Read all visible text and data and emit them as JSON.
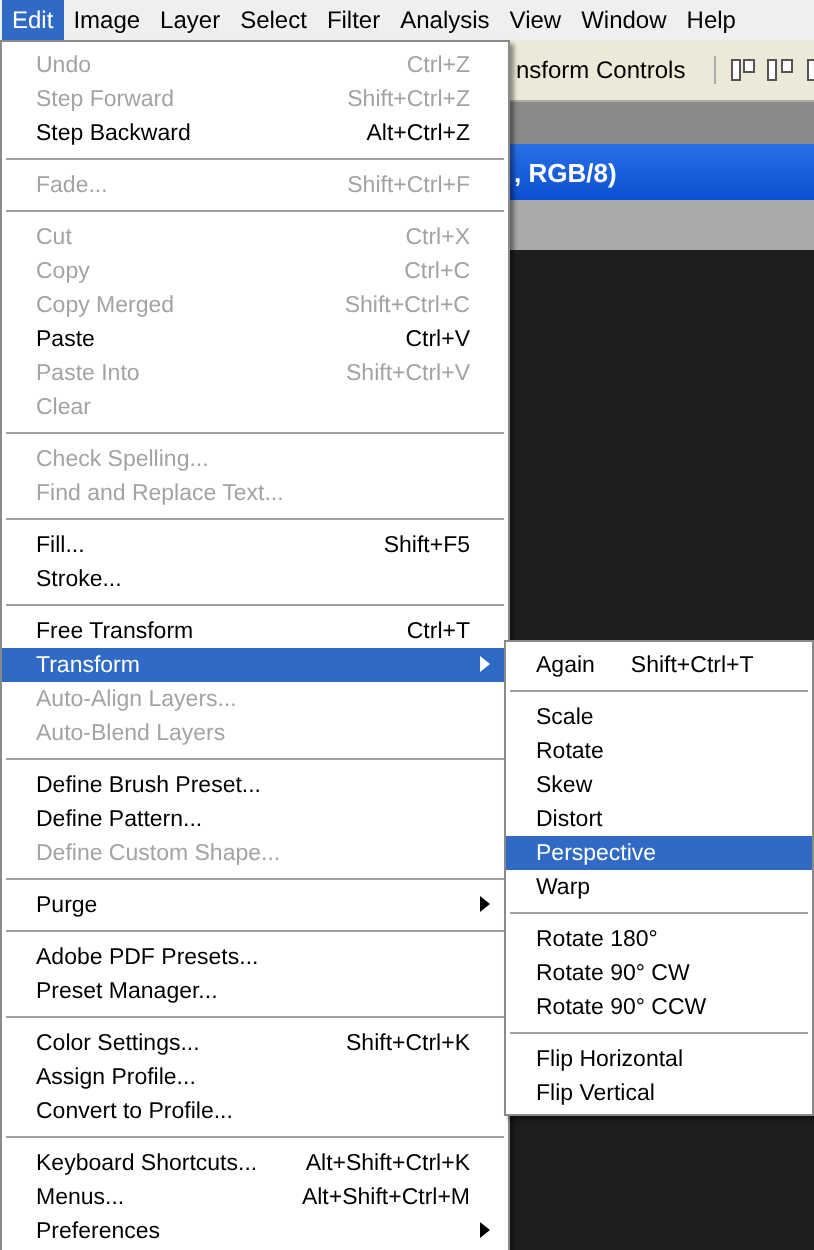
{
  "menu_bar": [
    {
      "label": "Edit",
      "selected": true
    },
    {
      "label": "Image",
      "selected": false
    },
    {
      "label": "Layer",
      "selected": false
    },
    {
      "label": "Select",
      "selected": false
    },
    {
      "label": "Filter",
      "selected": false
    },
    {
      "label": "Analysis",
      "selected": false
    },
    {
      "label": "View",
      "selected": false
    },
    {
      "label": "Window",
      "selected": false
    },
    {
      "label": "Help",
      "selected": false
    }
  ],
  "options_bar": {
    "label": "nsform Controls"
  },
  "document": {
    "title": ", RGB/8)"
  },
  "edit_menu": [
    {
      "kind": "item",
      "label": "Undo",
      "shortcut": "Ctrl+Z",
      "disabled": true,
      "selected": false,
      "submenu": false
    },
    {
      "kind": "item",
      "label": "Step Forward",
      "shortcut": "Shift+Ctrl+Z",
      "disabled": true,
      "selected": false,
      "submenu": false
    },
    {
      "kind": "item",
      "label": "Step Backward",
      "shortcut": "Alt+Ctrl+Z",
      "disabled": false,
      "selected": false,
      "submenu": false
    },
    {
      "kind": "separator"
    },
    {
      "kind": "item",
      "label": "Fade...",
      "shortcut": "Shift+Ctrl+F",
      "disabled": true,
      "selected": false,
      "submenu": false
    },
    {
      "kind": "separator"
    },
    {
      "kind": "item",
      "label": "Cut",
      "shortcut": "Ctrl+X",
      "disabled": true,
      "selected": false,
      "submenu": false
    },
    {
      "kind": "item",
      "label": "Copy",
      "shortcut": "Ctrl+C",
      "disabled": true,
      "selected": false,
      "submenu": false
    },
    {
      "kind": "item",
      "label": "Copy Merged",
      "shortcut": "Shift+Ctrl+C",
      "disabled": true,
      "selected": false,
      "submenu": false
    },
    {
      "kind": "item",
      "label": "Paste",
      "shortcut": "Ctrl+V",
      "disabled": false,
      "selected": false,
      "submenu": false
    },
    {
      "kind": "item",
      "label": "Paste Into",
      "shortcut": "Shift+Ctrl+V",
      "disabled": true,
      "selected": false,
      "submenu": false
    },
    {
      "kind": "item",
      "label": "Clear",
      "disabled": true,
      "selected": false,
      "submenu": false
    },
    {
      "kind": "separator"
    },
    {
      "kind": "item",
      "label": "Check Spelling...",
      "disabled": true,
      "selected": false,
      "submenu": false
    },
    {
      "kind": "item",
      "label": "Find and Replace Text...",
      "disabled": true,
      "selected": false,
      "submenu": false
    },
    {
      "kind": "separator"
    },
    {
      "kind": "item",
      "label": "Fill...",
      "shortcut": "Shift+F5",
      "disabled": false,
      "selected": false,
      "submenu": false
    },
    {
      "kind": "item",
      "label": "Stroke...",
      "disabled": false,
      "selected": false,
      "submenu": false
    },
    {
      "kind": "separator"
    },
    {
      "kind": "item",
      "label": "Free Transform",
      "shortcut": "Ctrl+T",
      "disabled": false,
      "selected": false,
      "submenu": false
    },
    {
      "kind": "item",
      "label": "Transform",
      "disabled": false,
      "selected": true,
      "submenu": true
    },
    {
      "kind": "item",
      "label": "Auto-Align Layers...",
      "disabled": true,
      "selected": false,
      "submenu": false
    },
    {
      "kind": "item",
      "label": "Auto-Blend Layers",
      "disabled": true,
      "selected": false,
      "submenu": false
    },
    {
      "kind": "separator"
    },
    {
      "kind": "item",
      "label": "Define Brush Preset...",
      "disabled": false,
      "selected": false,
      "submenu": false
    },
    {
      "kind": "item",
      "label": "Define Pattern...",
      "disabled": false,
      "selected": false,
      "submenu": false
    },
    {
      "kind": "item",
      "label": "Define Custom Shape...",
      "disabled": true,
      "selected": false,
      "submenu": false
    },
    {
      "kind": "separator"
    },
    {
      "kind": "item",
      "label": "Purge",
      "disabled": false,
      "selected": false,
      "submenu": true
    },
    {
      "kind": "separator"
    },
    {
      "kind": "item",
      "label": "Adobe PDF Presets...",
      "disabled": false,
      "selected": false,
      "submenu": false
    },
    {
      "kind": "item",
      "label": "Preset Manager...",
      "disabled": false,
      "selected": false,
      "submenu": false
    },
    {
      "kind": "separator"
    },
    {
      "kind": "item",
      "label": "Color Settings...",
      "shortcut": "Shift+Ctrl+K",
      "disabled": false,
      "selected": false,
      "submenu": false
    },
    {
      "kind": "item",
      "label": "Assign Profile...",
      "disabled": false,
      "selected": false,
      "submenu": false
    },
    {
      "kind": "item",
      "label": "Convert to Profile...",
      "disabled": false,
      "selected": false,
      "submenu": false
    },
    {
      "kind": "separator"
    },
    {
      "kind": "item",
      "label": "Keyboard Shortcuts...",
      "shortcut": "Alt+Shift+Ctrl+K",
      "disabled": false,
      "selected": false,
      "submenu": false
    },
    {
      "kind": "item",
      "label": "Menus...",
      "shortcut": "Alt+Shift+Ctrl+M",
      "disabled": false,
      "selected": false,
      "submenu": false
    },
    {
      "kind": "item",
      "label": "Preferences",
      "disabled": false,
      "selected": false,
      "submenu": true
    }
  ],
  "transform_submenu": [
    {
      "kind": "item",
      "label": "Again",
      "shortcut": "Shift+Ctrl+T",
      "selected": false
    },
    {
      "kind": "separator"
    },
    {
      "kind": "item",
      "label": "Scale",
      "selected": false
    },
    {
      "kind": "item",
      "label": "Rotate",
      "selected": false
    },
    {
      "kind": "item",
      "label": "Skew",
      "selected": false
    },
    {
      "kind": "item",
      "label": "Distort",
      "selected": false
    },
    {
      "kind": "item",
      "label": "Perspective",
      "selected": true
    },
    {
      "kind": "item",
      "label": "Warp",
      "selected": false
    },
    {
      "kind": "separator"
    },
    {
      "kind": "item",
      "label": "Rotate 180°",
      "selected": false
    },
    {
      "kind": "item",
      "label": "Rotate 90° CW",
      "selected": false
    },
    {
      "kind": "item",
      "label": "Rotate 90° CCW",
      "selected": false
    },
    {
      "kind": "separator"
    },
    {
      "kind": "item",
      "label": "Flip Horizontal",
      "selected": false
    },
    {
      "kind": "item",
      "label": "Flip Vertical",
      "selected": false
    }
  ]
}
